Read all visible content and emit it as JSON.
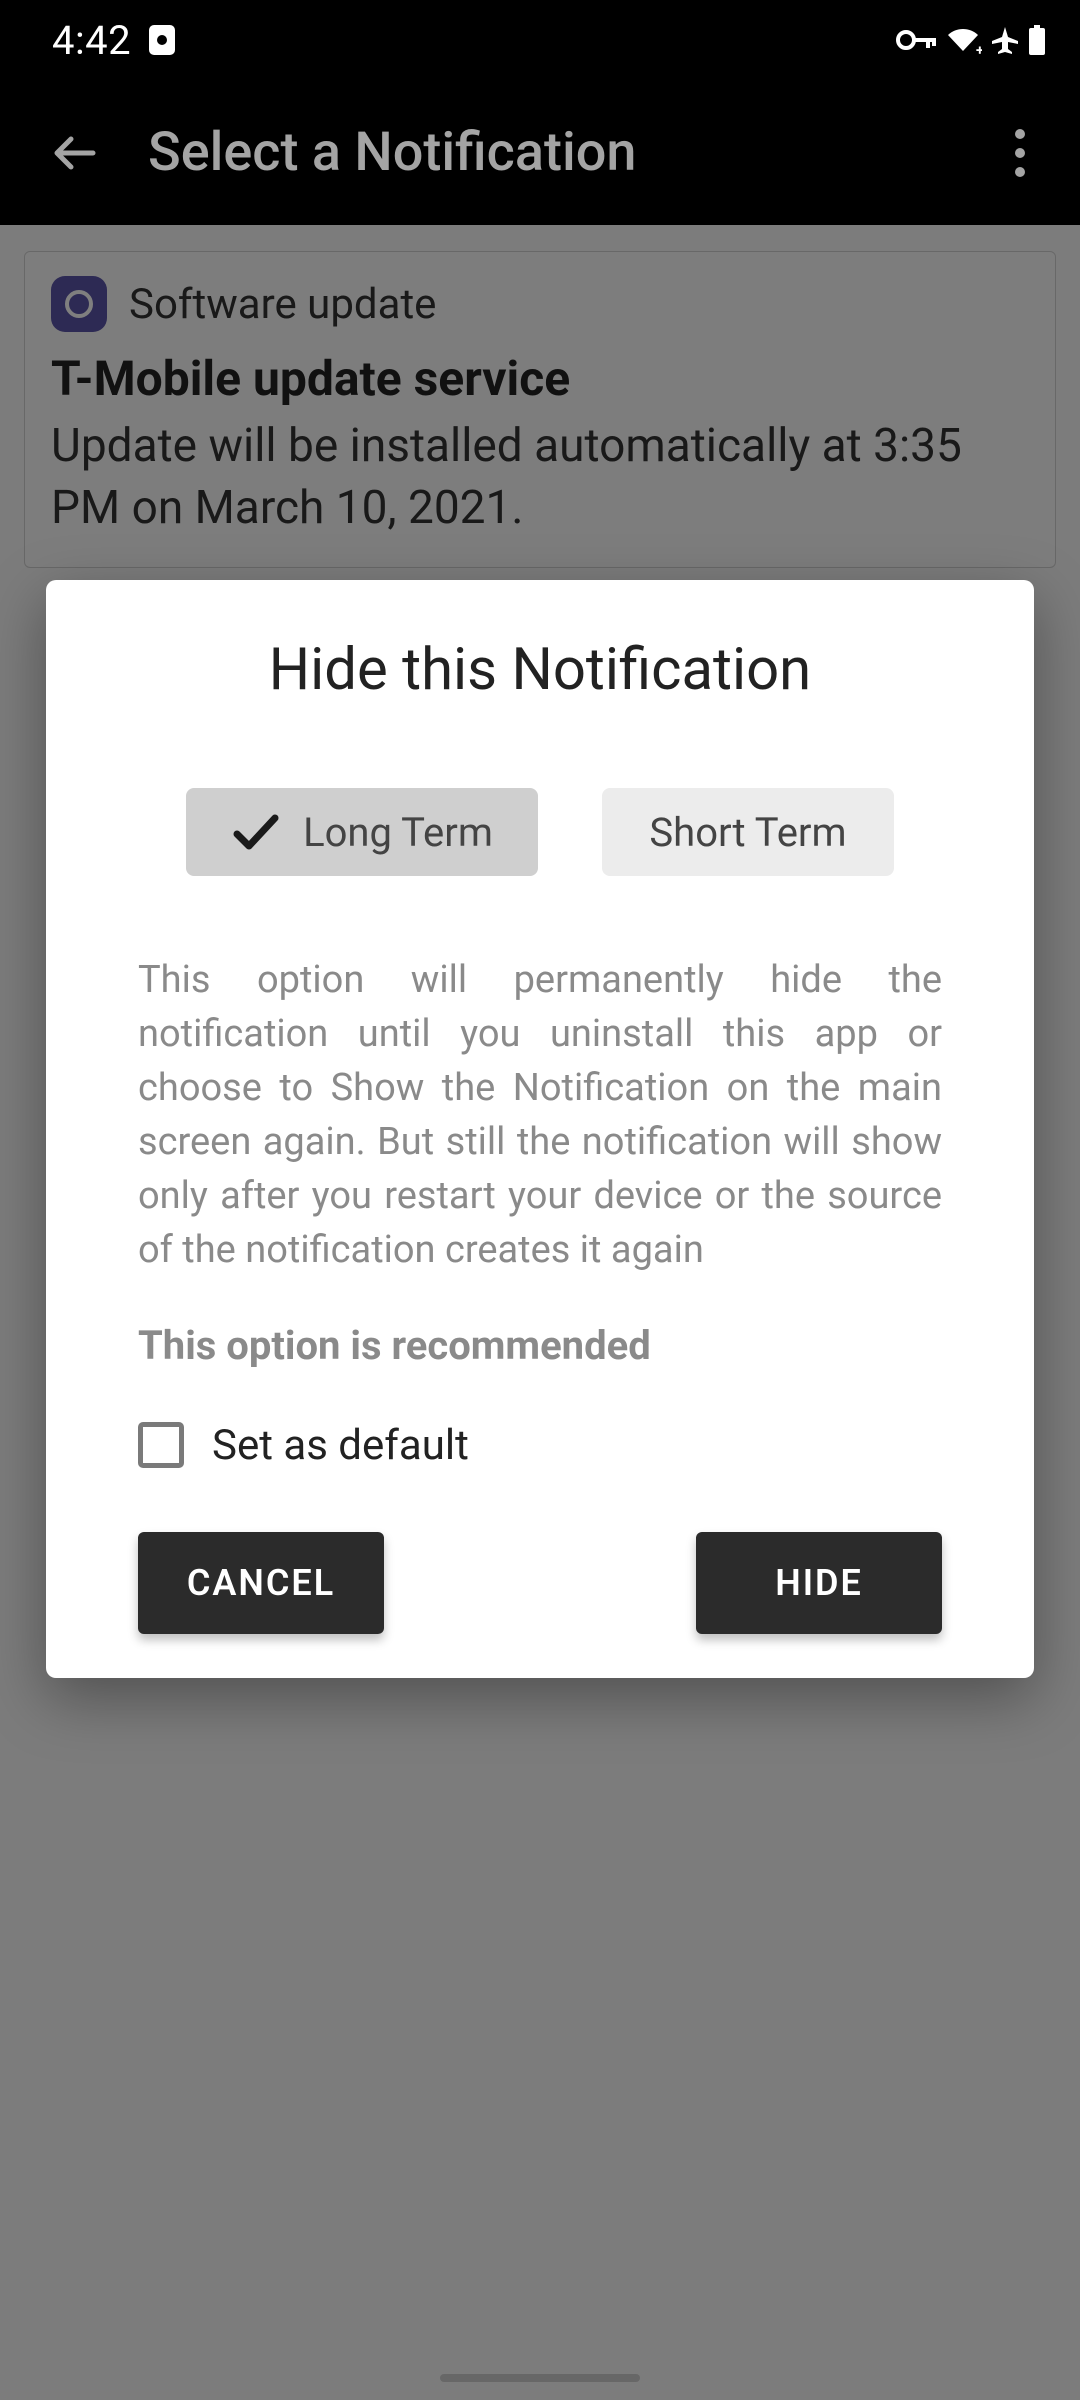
{
  "status": {
    "time": "4:42",
    "icons": [
      "app-indicator",
      "vpn-key",
      "wifi",
      "airplane",
      "battery"
    ]
  },
  "appbar": {
    "title": "Select a Notification"
  },
  "notification_card": {
    "app_name": "Software update",
    "title": "T-Mobile update service",
    "body": "Update will be installed automatically at 3:35 PM on March 10, 2021."
  },
  "dialog": {
    "title": "Hide this Notification",
    "tabs": {
      "long": "Long Term",
      "short": "Short Term",
      "selected": "long"
    },
    "description": "This option will permanently hide the notification until you uninstall this app or choose to Show the Notification on the main screen again. But still the notification will show only after you restart your device or the source of the notification creates it again",
    "recommended": "This option is recommended",
    "default_checkbox": {
      "label": "Set as default",
      "checked": false
    },
    "actions": {
      "cancel": "CANCEL",
      "hide": "HIDE"
    }
  }
}
